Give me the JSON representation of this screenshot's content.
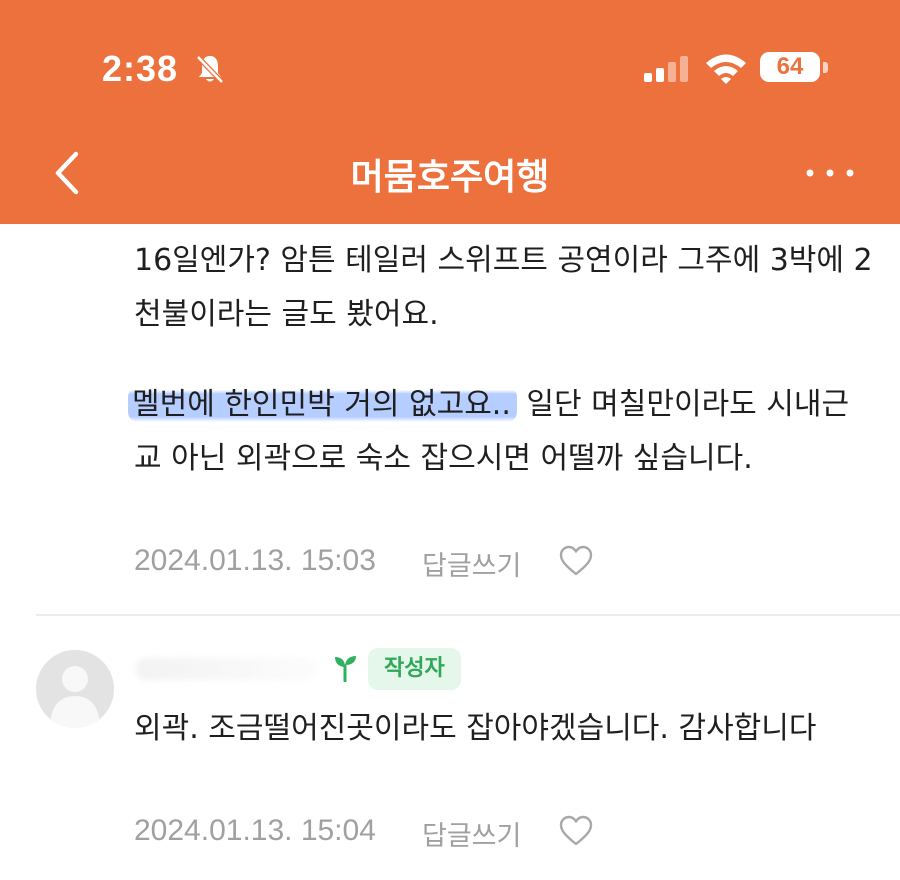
{
  "status_bar": {
    "time": "2:38",
    "battery": "64",
    "icons": [
      "bell-off-icon",
      "signal-icon",
      "wifi-icon",
      "battery-icon"
    ]
  },
  "nav": {
    "title": "머뭄호주여행",
    "back_icon": "chevron-left-icon",
    "more_icon": "more-horizontal-icon"
  },
  "colors": {
    "header": "#ec713d",
    "highlight": "#a8c4ff",
    "badge_bg": "#e5f7eb",
    "badge_text": "#2fa85a",
    "meta_text": "#a0a0a0"
  },
  "comments": [
    {
      "lines_before_highlight": "16일엔가? 암튼 테일러 스위프트 공연이라 그주에 3박에 2천불이라는 글도 봤어요.",
      "highlighted": "멜번에 한인민박 거의 없고요..",
      "after_highlight": " 일단 며칠만이라도 시내근교 아닌 외곽으로 숙소 잡으시면 어떨까 싶습니다.",
      "date": "2024.01.13. 15:03",
      "reply_label": "답글쓰기"
    },
    {
      "badge": "작성자",
      "text": "외곽. 조금떨어진곳이라도 잡아야겠습니다. 감사합니다",
      "date": "2024.01.13. 15:04",
      "reply_label": "답글쓰기"
    }
  ]
}
